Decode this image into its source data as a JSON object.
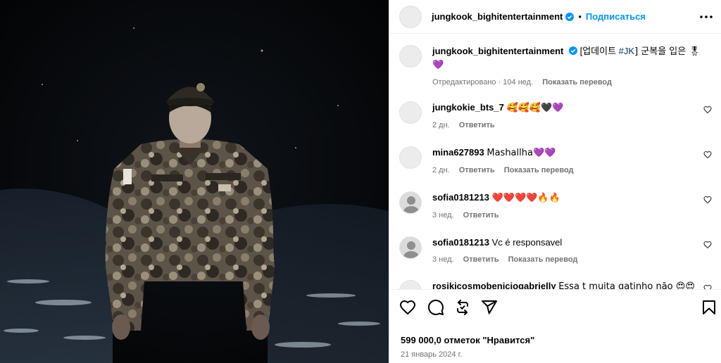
{
  "post": {
    "author": "jungkook_bighitentertainment",
    "follow_label": "Подписаться",
    "likes": "599 000,0 отметок \"Нравится\"",
    "date": "21 январь 2024 г."
  },
  "caption": {
    "author": "jungkook_bighitentertainment",
    "text_prefix": "[업데이트 ",
    "hashtag": "#JK",
    "text_suffix": "] 군복을 입은 🎖",
    "line2": "💜",
    "edited": "Отредактировано · 104 нед.",
    "translate": "Показать перевод"
  },
  "comments": [
    {
      "user": "jungkokie_bts_7",
      "text": "🥰🥰🥰🖤💜",
      "age": "2 дн.",
      "reply": "Ответить",
      "translate": ""
    },
    {
      "user": "mina627893",
      "text": "Mashallha💜💜",
      "age": "2 дн.",
      "reply": "Ответить",
      "translate": "Показать перевод"
    },
    {
      "user": "sofia0181213",
      "text": "❤️❤️❤️❤️🔥🔥",
      "age": "3 нед.",
      "reply": "Ответить",
      "translate": ""
    },
    {
      "user": "sofia0181213",
      "text": "Vc é responsavel",
      "age": "3 нед.",
      "reply": "Ответить",
      "translate": "Показать перевод"
    },
    {
      "user": "rosikicosmobeniciogabrielly",
      "text": "Essa t muita gatinho não 😍😍",
      "age": "",
      "reply": "",
      "translate": ""
    }
  ],
  "colors": {
    "accent": "#0095f6",
    "muted": "#737373",
    "verified": "#0095f6"
  },
  "icons": [
    "like-icon",
    "comment-icon",
    "share-icon",
    "send-icon",
    "save-icon",
    "more-icon"
  ]
}
